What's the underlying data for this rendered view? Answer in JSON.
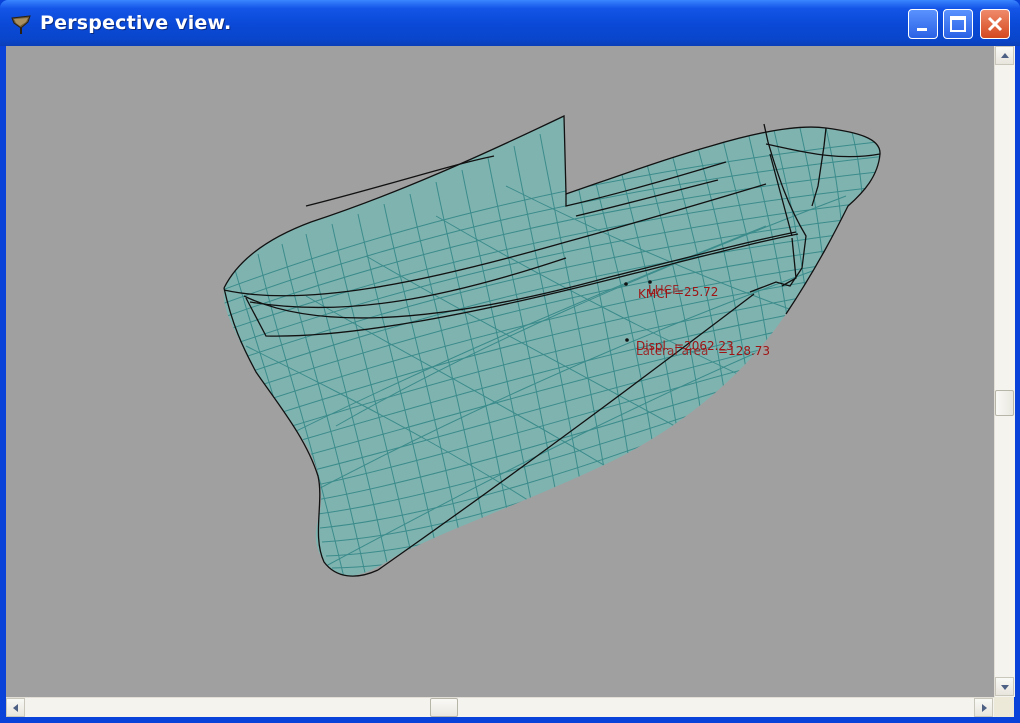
{
  "window": {
    "title": "Perspective view.",
    "buttons": {
      "minimize_icon": "minimize-icon",
      "maximize_icon": "maximize-icon",
      "close_icon": "close-icon"
    }
  },
  "viewport": {
    "background": "#a0a0a0",
    "mesh_color": "#4a9a9a",
    "outline_color": "#111111",
    "annotations": {
      "label_1a": "KMCF",
      "label_1b": "=25.72",
      "label_1c": "LHCF",
      "label_2a": "Displ.",
      "label_2b": "=2062.23",
      "label_2c": "Lateral area",
      "label_2d": "=128.73"
    },
    "annotation_color": "#9e1414"
  },
  "scrollbars": {
    "vertical_icons": [
      "scroll-up-icon",
      "scroll-down-icon"
    ],
    "horizontal_icons": [
      "scroll-left-icon",
      "scroll-right-icon"
    ]
  }
}
